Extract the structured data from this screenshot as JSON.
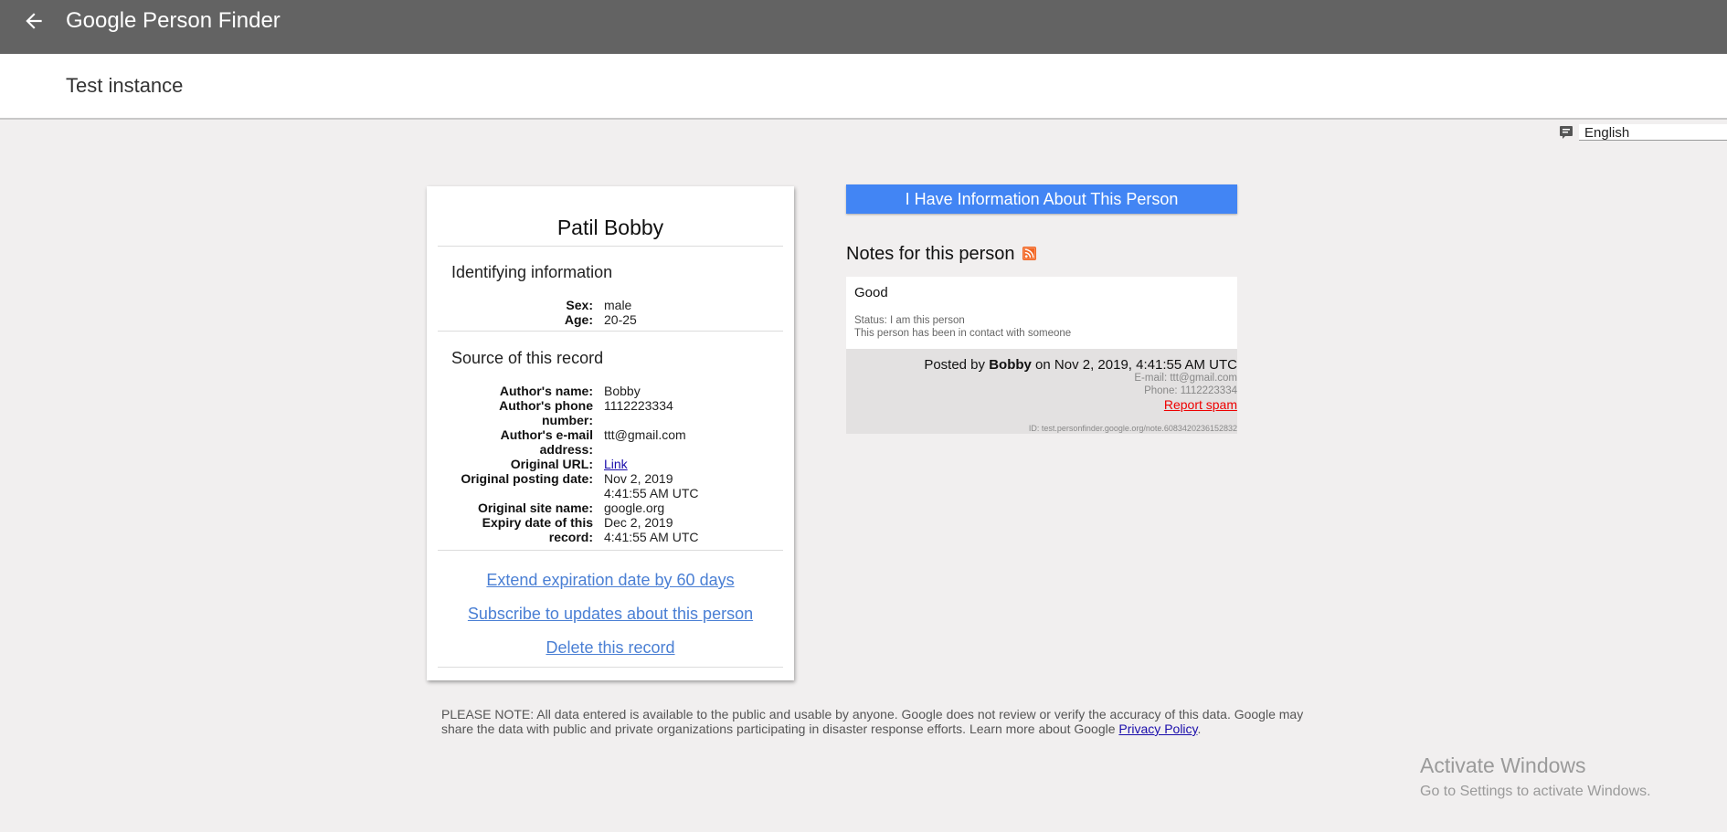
{
  "header": {
    "app_title": "Google Person Finder",
    "instance": "Test instance"
  },
  "language": {
    "selected": "English"
  },
  "person": {
    "name": "Patil Bobby",
    "identifying_title": "Identifying information",
    "sex_label": "Sex:",
    "sex": "male",
    "age_label": "Age:",
    "age": "20-25"
  },
  "source": {
    "title": "Source of this record",
    "author_name_label": "Author's name:",
    "author_name": "Bobby",
    "author_phone_label_1": "Author's phone",
    "author_phone_label_2": "number:",
    "author_phone": "1112223334",
    "author_email_label_1": "Author's e-mail",
    "author_email_label_2": "address:",
    "author_email": "ttt@gmail.com",
    "original_url_label": "Original URL:",
    "original_url": "Link",
    "posting_date_label": "Original posting date:",
    "posting_date_1": "Nov 2, 2019",
    "posting_date_2": "4:41:55 AM UTC",
    "site_name_label": "Original site name:",
    "site_name": "google.org",
    "expiry_label_1": "Expiry date of this",
    "expiry_label_2": "record:",
    "expiry_1": "Dec 2, 2019",
    "expiry_2": "4:41:55 AM UTC"
  },
  "actions": {
    "extend": "Extend expiration date by 60 days",
    "subscribe": "Subscribe to updates about this person",
    "delete": "Delete this record"
  },
  "info_button": "I Have Information About This Person",
  "notes": {
    "title": "Notes for this person",
    "items": [
      {
        "text": "Good",
        "status": "Status: I am this person",
        "contact": "This person has been in contact with someone",
        "posted_prefix": "Posted by ",
        "author": "Bobby",
        "posted_suffix": " on Nov 2, 2019, 4:41:55 AM UTC",
        "email": "E-mail: ttt@gmail.com",
        "phone": "Phone: 1112223334",
        "report_spam": "Report spam",
        "id": "ID: test.personfinder.google.org/note.6083420236152832"
      }
    ]
  },
  "disclaimer": {
    "text": "PLEASE NOTE: All data entered is available to the public and usable by anyone. Google does not review or verify the accuracy of this data. Google may share the data with public and private organizations participating in disaster response efforts. Learn more about Google ",
    "privacy_link": "Privacy Policy",
    "end": "."
  },
  "watermark": {
    "line1": "Activate Windows",
    "line2": "Go to Settings to activate Windows."
  },
  "colors": {
    "topbar": "#636363",
    "primary_button": "#4285f4",
    "link": "#4a7fd4",
    "spam": "#e00000"
  }
}
